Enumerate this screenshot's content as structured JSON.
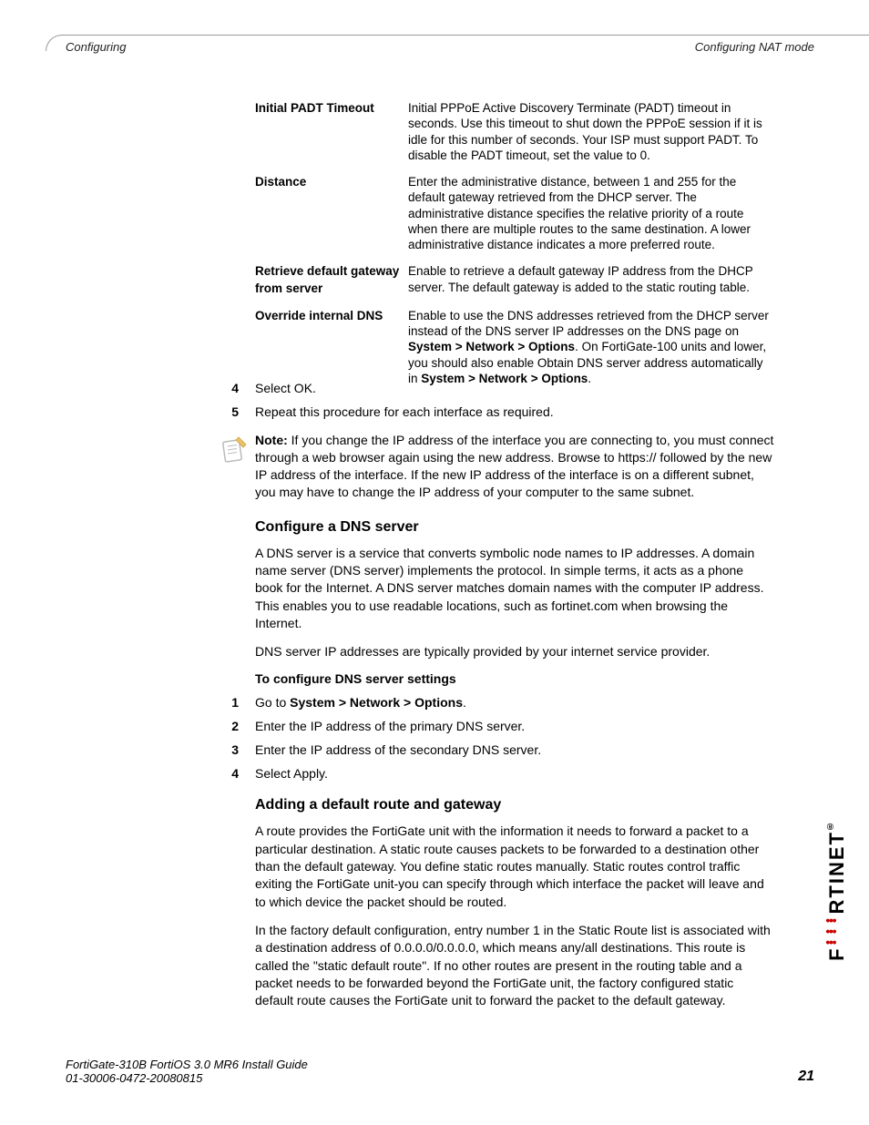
{
  "header": {
    "left": "Configuring",
    "right": "Configuring NAT mode"
  },
  "defs": [
    {
      "term": "Initial PADT Timeout",
      "desc": "Initial PPPoE Active Discovery Terminate (PADT) timeout in seconds. Use this timeout to shut down the PPPoE session if it is idle for this number of seconds. Your ISP must support PADT. To disable the PADT timeout, set the value to 0."
    },
    {
      "term": "Distance",
      "desc": "Enter the administrative distance, between 1 and 255 for the default gateway retrieved from the DHCP server. The administrative distance specifies the relative priority of a route when there are multiple routes to the same destination. A lower administrative distance indicates a more preferred route."
    },
    {
      "term": "Retrieve default gateway from server",
      "desc": "Enable to retrieve a default gateway IP address from the DHCP server. The default gateway is added to the static routing table."
    },
    {
      "term": "Override internal DNS",
      "desc_pre": "Enable to use the DNS addresses retrieved from the DHCP server instead of the DNS server IP addresses on the DNS page on ",
      "desc_bold1": "System > Network > Options",
      "desc_mid": ". On FortiGate-100 units and lower, you should also enable Obtain DNS server address automatically in ",
      "desc_bold2": "System > Network > Options",
      "desc_post": "."
    }
  ],
  "steps_a": [
    {
      "n": "4",
      "t": "Select OK."
    },
    {
      "n": "5",
      "t": "Repeat this procedure for each interface as required."
    }
  ],
  "note": {
    "label": "Note:",
    "text": " If you change the IP address of the interface you are connecting to, you must connect through a web browser again using the new address. Browse to https:// followed by the new IP address of the interface. If the new IP address of the interface is on a different subnet, you may have to change the IP address of your computer to the same subnet."
  },
  "sec_dns": {
    "heading": "Configure a DNS server",
    "p1": "A DNS server is a service that converts symbolic node names to IP addresses. A domain name server (DNS server) implements the protocol. In simple terms, it acts as a phone book for the Internet. A DNS server matches domain names with the computer IP address. This enables you to use readable locations, such as fortinet.com when browsing the Internet.",
    "p2": "DNS server IP addresses are typically provided by your internet service provider.",
    "proc_title": "To configure DNS server settings",
    "steps": [
      {
        "n": "1",
        "pre": "Go to ",
        "bold": "System > Network > Options",
        "post": "."
      },
      {
        "n": "2",
        "t": "Enter the IP address of the primary DNS server."
      },
      {
        "n": "3",
        "t": "Enter the IP address of the secondary DNS server."
      },
      {
        "n": "4",
        "t": "Select Apply."
      }
    ]
  },
  "sec_route": {
    "heading": "Adding a default route and gateway",
    "p1": "A route provides the FortiGate unit with the information it needs to forward a packet to a particular destination. A static route causes packets to be forwarded to a destination other than the default gateway. You define static routes manually. Static routes control traffic exiting the FortiGate unit-you can specify through which interface the packet will leave and to which device the packet should be routed.",
    "p2": "In the factory default configuration, entry number 1 in the Static Route list is associated with a destination address of 0.0.0.0/0.0.0.0, which means any/all destinations. This route is called the \"static default route\". If no other routes are present in the routing table and a packet needs to be forwarded beyond the FortiGate unit, the factory configured static default route causes the FortiGate unit to forward the packet to the default gateway."
  },
  "footer": {
    "line1": "FortiGate-310B FortiOS 3.0 MR6 Install Guide",
    "line2": "01-30006-0472-20080815",
    "page": "21"
  },
  "brand": "F RTINET"
}
